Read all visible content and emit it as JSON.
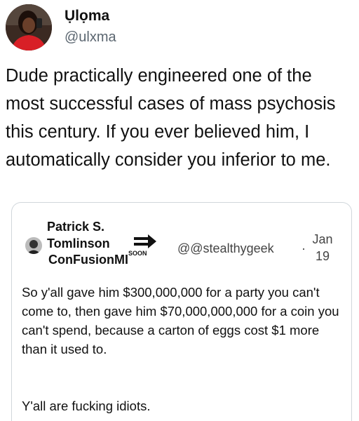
{
  "tweet": {
    "display_name": "Ụlọma",
    "handle": "@ulxma",
    "text": "Dude practically engineered one of the most successful cases of mass psychosis this century. If you ever believed him, I automatically consider you inferior to me."
  },
  "quoted": {
    "name_line1": "Patrick S.",
    "name_line2": "Tomlinson",
    "name_line3": "ConFusionMI",
    "soon_label": "SOON",
    "handle": "@@stealthygeek",
    "separator": "·",
    "date_line1": "Jan",
    "date_line2": "19",
    "text": "So y'all gave him $300,000,000 for a party you can't come to, then gave him $70,000,000,000 for a coin you can't spend, because a carton of eggs cost $1 more than it used to.",
    "text2": "Y'all are fucking idiots."
  },
  "icons": {
    "avatar": "profile-photo",
    "quote_avatar": "profile-photo-small",
    "soon": "soon-arrow-icon"
  },
  "colors": {
    "text": "#111111",
    "secondary": "#5b6670",
    "border": "#d0d6db"
  }
}
